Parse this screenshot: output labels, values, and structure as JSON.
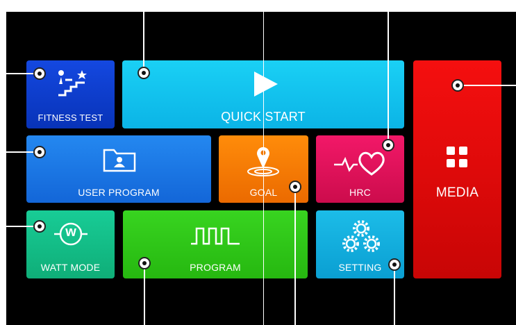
{
  "tiles": {
    "fitness_test": {
      "label": "FITNESS TEST",
      "color": "#0a3fd4"
    },
    "quick_start": {
      "label": "QUICK START",
      "color": "#12c8f2"
    },
    "media": {
      "label": "MEDIA",
      "color": "#ee0a0a"
    },
    "user_program": {
      "label": "USER PROGRAM",
      "color": "#1a7ae8"
    },
    "goal": {
      "label": "GOAL",
      "color": "#f57c00"
    },
    "hrc": {
      "label": "HRC",
      "color": "#e0105a"
    },
    "watt_mode": {
      "label": "WATT MODE",
      "color": "#14c28a"
    },
    "program": {
      "label": "PROGRAM",
      "color": "#30c81a"
    },
    "setting": {
      "label": "SETTING",
      "color": "#10aee0"
    }
  },
  "icons": {
    "fitness_test": "stairs-star-icon",
    "quick_start": "play-icon",
    "media": "grid-icon",
    "user_program": "user-folder-icon",
    "goal": "target-pin-icon",
    "hrc": "heartbeat-icon",
    "watt_mode": "watt-icon",
    "program": "pulse-wave-icon",
    "setting": "gears-icon"
  },
  "watt_letter": "w"
}
